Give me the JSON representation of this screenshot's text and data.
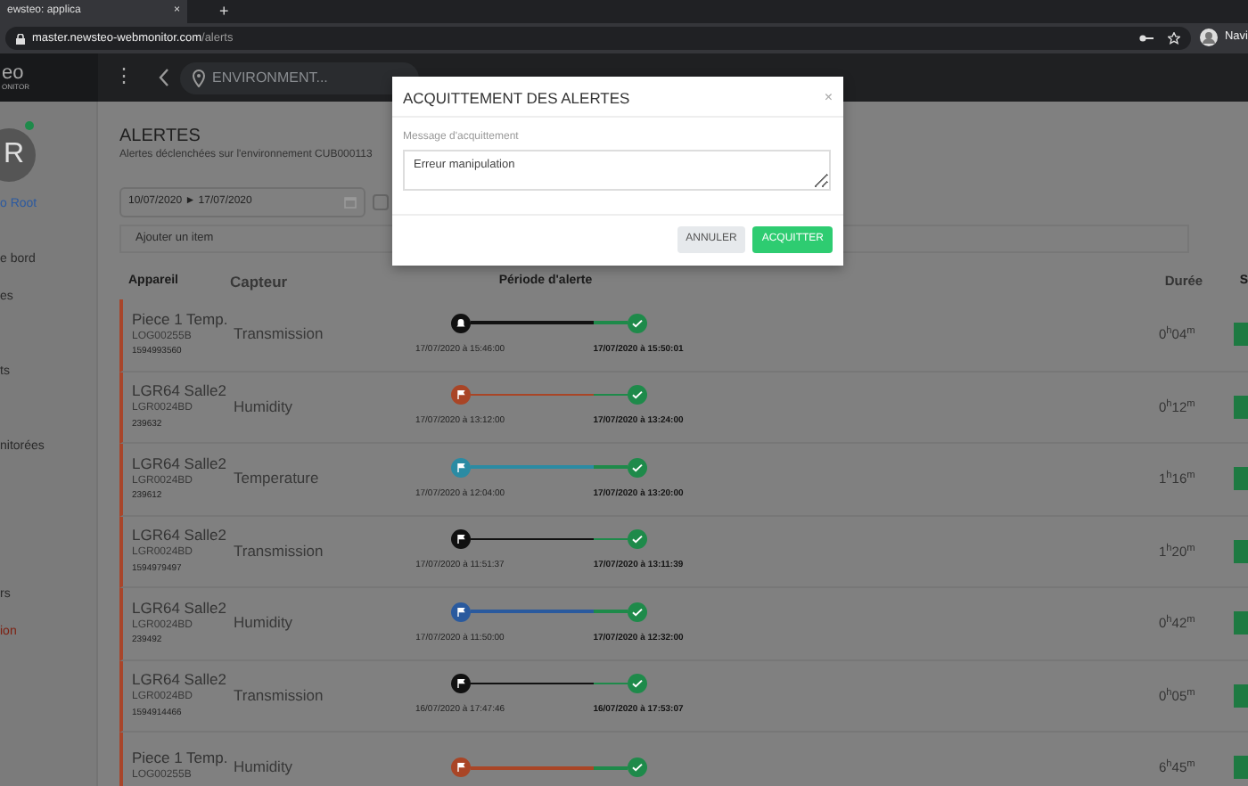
{
  "browser": {
    "tab_title": "ewsteo: applica",
    "tab_close": "×",
    "new_tab": "+",
    "url_host": "master.newsteo-webmonitor.com",
    "url_path": "/alerts",
    "profile": "Navi"
  },
  "app_header": {
    "logo_line_1": "eo",
    "logo_line_2": "ONITOR",
    "menu": "⋮",
    "environment_field": {
      "placeholder": "ENVIRONMENT..."
    }
  },
  "sidebar": {
    "avatar_initial": "R",
    "user_name": "o Root",
    "items": [
      {
        "label": "e bord",
        "kind": "link"
      },
      {
        "label": "es",
        "kind": "link"
      },
      {
        "label": "ts",
        "kind": "link"
      },
      {
        "label": "nitorées",
        "kind": "link"
      },
      {
        "label": "rs",
        "kind": "link"
      },
      {
        "label": "ion",
        "kind": "logout"
      }
    ]
  },
  "page": {
    "title": "ALERTES",
    "subtitle": "Alertes déclenchées sur l'environnement CUB000113",
    "date_range": {
      "value": "10/07/2020 ► 17/07/2020"
    },
    "checkbox": {
      "checked": false
    },
    "add_item": {
      "placeholder": "Ajouter un item"
    }
  },
  "table": {
    "columns": [
      "Appareil",
      "Capteur",
      "Période d'alerte",
      "Durée",
      "S"
    ],
    "rows": [
      {
        "device": "Piece 1 Temp.",
        "device_id": "LOG00255B",
        "serial": "1594993560",
        "sensor": "Transmission",
        "kind": "bell",
        "color": "#111111",
        "start": "17/07/2020 à 15:46:00",
        "end": "17/07/2020 à 15:50:01",
        "duration": "0$^{h}$04$^{m}$"
      },
      {
        "device": "LGR64 Salle2",
        "device_id": "LGR0024BD",
        "serial": "239632",
        "sensor": "Humidity",
        "kind": "flag",
        "color": "#a94526",
        "start": "17/07/2020 à 13:12:00",
        "end": "17/07/2020 à 13:24:00",
        "duration": "0$^{h}$12$^{m}$"
      },
      {
        "device": "LGR64 Salle2",
        "device_id": "LGR0024BD",
        "serial": "239612",
        "sensor": "Temperature",
        "kind": "flag",
        "color": "#2b8ba3",
        "start": "17/07/2020 à 12:04:00",
        "end": "17/07/2020 à 13:20:00",
        "duration": "1$^{h}$16$^{m}$"
      },
      {
        "device": "LGR64 Salle2",
        "device_id": "LGR0024BD",
        "serial": "1594979497",
        "sensor": "Transmission",
        "kind": "flag",
        "color": "#111111",
        "start": "17/07/2020 à 11:51:37",
        "end": "17/07/2020 à 13:11:39",
        "duration": "1$^{h}$20$^{m}$"
      },
      {
        "device": "LGR64 Salle2",
        "device_id": "LGR0024BD",
        "serial": "239492",
        "sensor": "Humidity",
        "kind": "flag",
        "color": "#2a5a9e",
        "start": "17/07/2020 à 11:50:00",
        "end": "17/07/2020 à 12:32:00",
        "duration": "0$^{h}$42$^{m}$"
      },
      {
        "device": "LGR64 Salle2",
        "device_id": "LGR0024BD",
        "serial": "1594914466",
        "sensor": "Transmission",
        "kind": "flag",
        "color": "#111111",
        "start": "16/07/2020 à 17:47:46",
        "end": "16/07/2020 à 17:53:07",
        "duration": "0$^{h}$05$^{m}$"
      },
      {
        "device": "Piece 1 Temp.",
        "device_id": "LOG00255B",
        "sensor": "Humidity",
        "kind": "flag",
        "color": "#a94526",
        "duration": "6$^{h}$45$^{m}$"
      }
    ]
  },
  "modal": {
    "title": "ACQUITTEMENT DES ALERTES",
    "close": "×",
    "field_label": "Message d'acquittement",
    "message": "Erreur manipulation",
    "buttons": [
      {
        "label": "ANNULER",
        "kind": "secondary"
      },
      {
        "label": "ACQUITTER",
        "kind": "primary"
      }
    ]
  }
}
